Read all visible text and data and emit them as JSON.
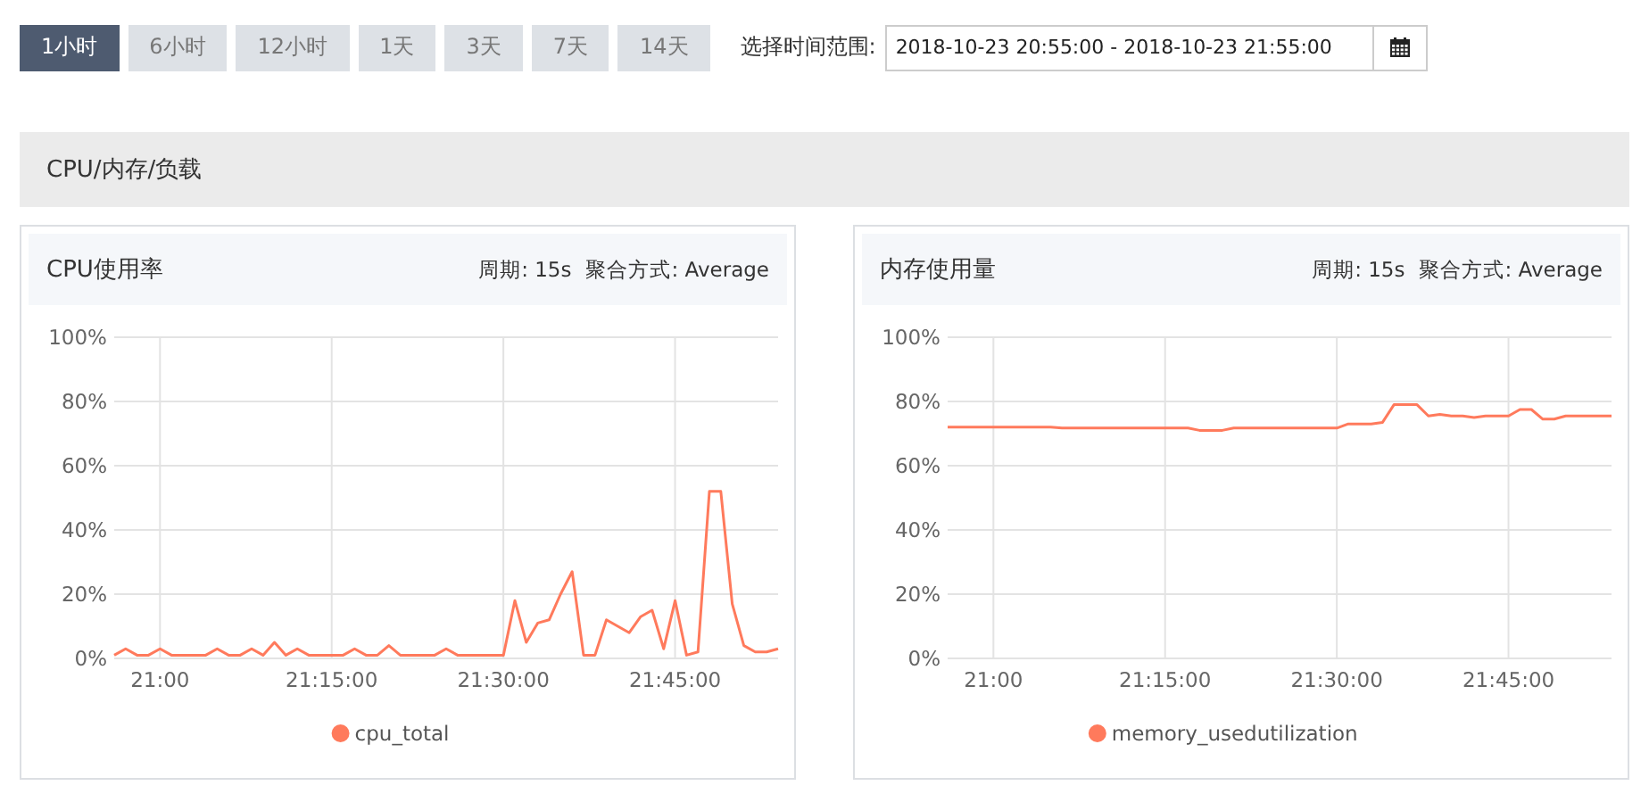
{
  "time_range_buttons": [
    {
      "label": "1小时",
      "selected": true
    },
    {
      "label": "6小时",
      "selected": false
    },
    {
      "label": "12小时",
      "selected": false
    },
    {
      "label": "1天",
      "selected": false
    },
    {
      "label": "3天",
      "selected": false
    },
    {
      "label": "7天",
      "selected": false
    },
    {
      "label": "14天",
      "selected": false
    }
  ],
  "range_picker": {
    "label": "选择时间范围:",
    "value": "2018-10-23 20:55:00 - 2018-10-23 21:55:00"
  },
  "section": {
    "title": "CPU/内存/负载"
  },
  "panels": [
    {
      "title": "CPU使用率",
      "period": "周期: 15s",
      "aggregation": "聚合方式: Average",
      "chart_data": {
        "type": "line",
        "categories": [
          null,
          null,
          null,
          null,
          "21:00",
          null,
          null,
          null,
          null,
          null,
          null,
          null,
          null,
          null,
          null,
          null,
          null,
          null,
          null,
          "21:15:00",
          null,
          null,
          null,
          null,
          null,
          null,
          null,
          null,
          null,
          null,
          null,
          null,
          null,
          null,
          "21:30:00",
          null,
          null,
          null,
          null,
          null,
          null,
          null,
          null,
          null,
          null,
          null,
          null,
          null,
          null,
          "21:45:00",
          null,
          null,
          null,
          null,
          null,
          null,
          null,
          null,
          null
        ],
        "grid": true,
        "series": [
          {
            "name": "cpu_total",
            "color": "#ff7a5c",
            "values": [
              1,
              3,
              1,
              1,
              3,
              1,
              1,
              1,
              1,
              3,
              1,
              1,
              3,
              1,
              5,
              1,
              3,
              1,
              1,
              1,
              1,
              3,
              1,
              1,
              4,
              1,
              1,
              1,
              1,
              3,
              1,
              1,
              1,
              1,
              1,
              18,
              5,
              11,
              12,
              20,
              27,
              1,
              1,
              12,
              10,
              8,
              13,
              15,
              3,
              18,
              1,
              2,
              52,
              52,
              17,
              4,
              2,
              2,
              3
            ]
          }
        ],
        "ylim": [
          0,
          100
        ],
        "yticks": [
          {
            "value": 0,
            "label": "0%"
          },
          {
            "value": 20,
            "label": "20%"
          },
          {
            "value": 40,
            "label": "40%"
          },
          {
            "value": 60,
            "label": "60%"
          },
          {
            "value": 80,
            "label": "80%"
          },
          {
            "value": 100,
            "label": "100%"
          }
        ]
      }
    },
    {
      "title": "内存使用量",
      "period": "周期: 15s",
      "aggregation": "聚合方式: Average",
      "chart_data": {
        "type": "line",
        "categories": [
          null,
          null,
          null,
          null,
          "21:00",
          null,
          null,
          null,
          null,
          null,
          null,
          null,
          null,
          null,
          null,
          null,
          null,
          null,
          null,
          "21:15:00",
          null,
          null,
          null,
          null,
          null,
          null,
          null,
          null,
          null,
          null,
          null,
          null,
          null,
          null,
          "21:30:00",
          null,
          null,
          null,
          null,
          null,
          null,
          null,
          null,
          null,
          null,
          null,
          null,
          null,
          null,
          "21:45:00",
          null,
          null,
          null,
          null,
          null,
          null,
          null,
          null,
          null
        ],
        "grid": true,
        "series": [
          {
            "name": "memory_usedutilization",
            "color": "#ff7a5c",
            "values": [
              72,
              72,
              72,
              72,
              72,
              72,
              72,
              72,
              72,
              72,
              71.7,
              71.7,
              71.7,
              71.7,
              71.7,
              71.7,
              71.7,
              71.7,
              71.7,
              71.7,
              71.7,
              71.7,
              71,
              71,
              71,
              71.7,
              71.7,
              71.7,
              71.7,
              71.7,
              71.7,
              71.7,
              71.7,
              71.7,
              71.7,
              73,
              73,
              73,
              73.5,
              79,
              79,
              79,
              75.5,
              76,
              75.5,
              75.5,
              75,
              75.5,
              75.5,
              75.5,
              77.5,
              77.5,
              74.5,
              74.5,
              75.5,
              75.5,
              75.5,
              75.5,
              75.5
            ]
          }
        ],
        "ylim": [
          0,
          100
        ],
        "yticks": [
          {
            "value": 0,
            "label": "0%"
          },
          {
            "value": 20,
            "label": "20%"
          },
          {
            "value": 40,
            "label": "40%"
          },
          {
            "value": 60,
            "label": "60%"
          },
          {
            "value": 80,
            "label": "80%"
          },
          {
            "value": 100,
            "label": "100%"
          }
        ]
      }
    }
  ]
}
